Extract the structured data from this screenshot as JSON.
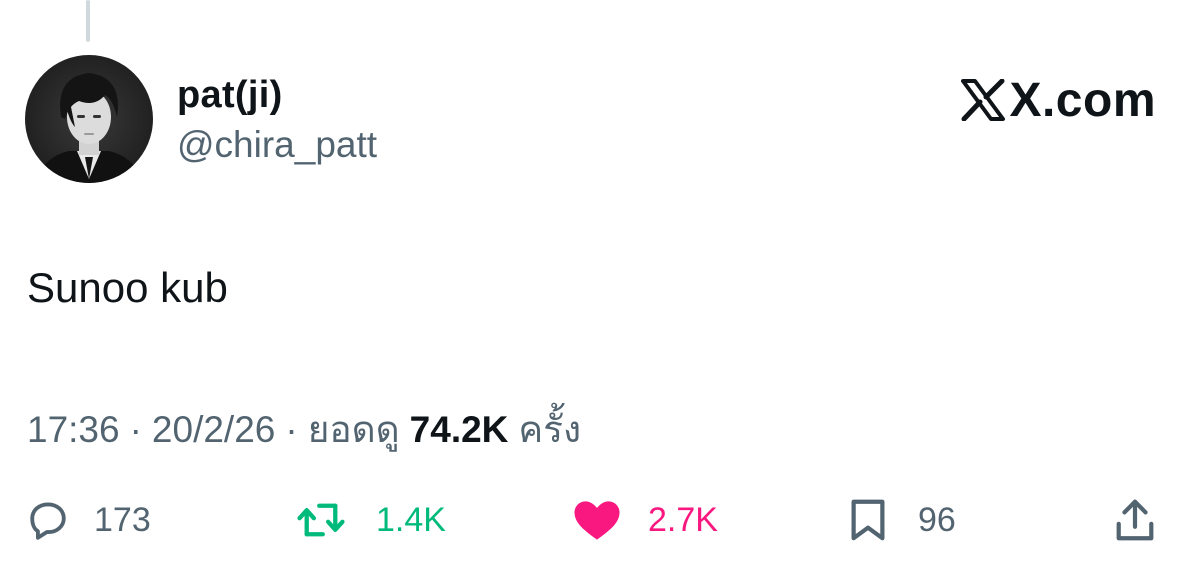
{
  "tweet": {
    "author": {
      "display_name": "pat(ji)",
      "handle": "@chira_patt"
    },
    "brand": "X.com",
    "text": "Sunoo kub",
    "meta": {
      "time": "17:36",
      "separator": "·",
      "date": "20/2/26",
      "views_label": "ยอดดู",
      "views_count": "74.2K",
      "views_suffix": "ครั้ง"
    }
  },
  "actions": {
    "replies": "173",
    "reposts": "1.4K",
    "likes": "2.7K",
    "bookmarks": "96"
  },
  "icons": {
    "reply": "speech-bubble-icon",
    "repost": "repost-arrows-icon",
    "like": "heart-icon",
    "bookmark": "bookmark-icon",
    "share": "share-upload-icon"
  },
  "colors": {
    "text_primary": "#0f1419",
    "text_secondary": "#536471",
    "repost_active": "#00ba7c",
    "like_active": "#f91880",
    "thread_line": "#cfd9de"
  }
}
